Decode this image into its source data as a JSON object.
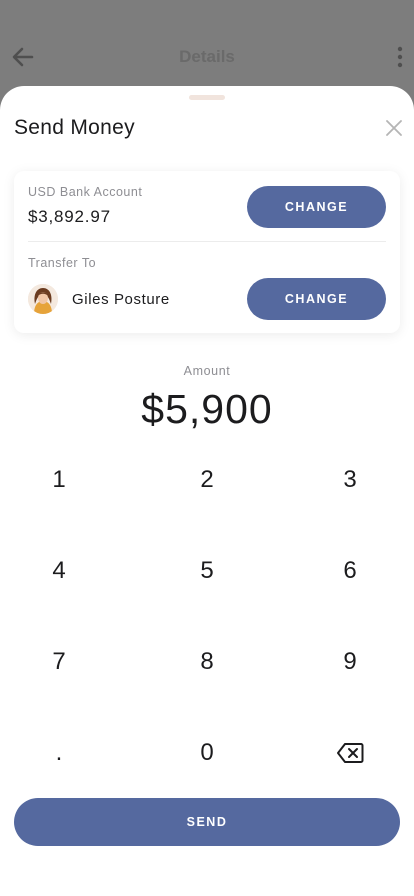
{
  "background": {
    "title": "Details",
    "back_icon": "arrow-left-icon",
    "more_icon": "more-vertical-icon"
  },
  "sheet": {
    "title": "Send Money",
    "close_icon": "close-icon"
  },
  "account": {
    "label": "USD Bank Account",
    "balance": "$3,892.97",
    "change_label": "CHANGE"
  },
  "transfer": {
    "label": "Transfer To",
    "recipient_name": "Giles Posture",
    "avatar_icon": "avatar",
    "change_label": "CHANGE"
  },
  "amount": {
    "label": "Amount",
    "value": "$5,900"
  },
  "keypad": {
    "keys": [
      "1",
      "2",
      "3",
      "4",
      "5",
      "6",
      "7",
      "8",
      "9",
      ".",
      "0"
    ],
    "backspace_icon": "backspace-icon"
  },
  "send_label": "SEND",
  "colors": {
    "accent": "#55699f",
    "overlay": "#7d7d7d",
    "sheet": "#ffffff"
  }
}
